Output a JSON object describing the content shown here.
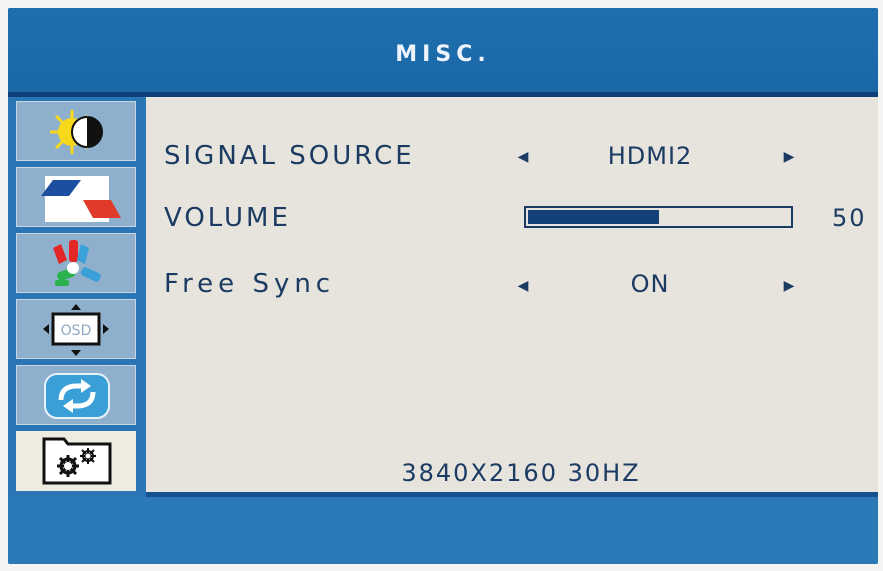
{
  "title": "MISC.",
  "sidebar": {
    "items": [
      {
        "name": "brightness-contrast",
        "icon": "sun-contrast-icon"
      },
      {
        "name": "image",
        "icon": "image-icon"
      },
      {
        "name": "color",
        "icon": "color-icon"
      },
      {
        "name": "osd",
        "icon": "osd-position-icon",
        "label": "OSD"
      },
      {
        "name": "reset",
        "icon": "reset-icon"
      },
      {
        "name": "misc",
        "icon": "gear-folder-icon",
        "active": true
      }
    ]
  },
  "settings": {
    "signal_source": {
      "label": "SIGNAL SOURCE",
      "value": "HDMI2"
    },
    "volume": {
      "label": "VOLUME",
      "value": "50",
      "level": 0.5
    },
    "free_sync": {
      "label": "Free Sync",
      "value": "ON"
    }
  },
  "resolution": "3840X2160 30HZ",
  "colors": {
    "header": "#1f6fae",
    "panel": "#e6e4dc",
    "text": "#1b3b63",
    "accent": "#14407a"
  }
}
